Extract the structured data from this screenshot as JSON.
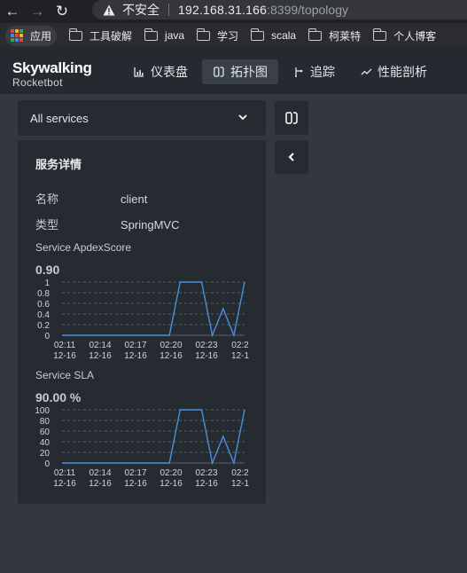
{
  "browser": {
    "insecure_label": "不安全",
    "url_host": "192.168.31.166",
    "url_rest": ":8399/topology",
    "bookmarks": [
      "应用",
      "工具破解",
      "java",
      "学习",
      "scala",
      "柯莱特",
      "个人博客"
    ]
  },
  "app": {
    "logo_main": "Skywalking",
    "logo_sub": "Rocketbot",
    "nav": [
      {
        "label": "仪表盘",
        "icon": "bar-chart-icon"
      },
      {
        "label": "拓扑图",
        "icon": "topology-icon"
      },
      {
        "label": "追踪",
        "icon": "trace-icon"
      },
      {
        "label": "性能剖析",
        "icon": "profile-line-icon"
      }
    ],
    "active_tab": "拓扑图"
  },
  "service_select": {
    "value": "All services"
  },
  "service_details": {
    "title": "服务详情",
    "fields": [
      {
        "key": "名称",
        "value": "client"
      },
      {
        "key": "类型",
        "value": "SpringMVC"
      }
    ]
  },
  "chart_data": [
    {
      "type": "line",
      "title": "Service ApdexScore",
      "current_value": "0.90",
      "x": [
        0,
        1,
        2,
        3,
        4,
        5,
        6,
        7,
        8,
        9,
        10,
        11,
        12,
        13,
        14,
        15,
        16
      ],
      "values": [
        0,
        0,
        0,
        0,
        0,
        0,
        0,
        0,
        0,
        0,
        0,
        1,
        1,
        1,
        0,
        0.5,
        0,
        1
      ],
      "x_tick_labels": [
        [
          "02:11",
          "12-16"
        ],
        [
          "02:14",
          "12-16"
        ],
        [
          "02:17",
          "12-16"
        ],
        [
          "02:20",
          "12-16"
        ],
        [
          "02:23",
          "12-16"
        ],
        [
          "02:2",
          "12-1"
        ]
      ],
      "y_ticks": [
        "1",
        "0.8",
        "0.6",
        "0.4",
        "0.2",
        "0"
      ],
      "ylim": [
        0,
        1
      ],
      "color": "#4a90d9"
    },
    {
      "type": "line",
      "title": "Service SLA",
      "current_value": "90.00 %",
      "values": [
        0,
        0,
        0,
        0,
        0,
        0,
        0,
        0,
        0,
        0,
        0,
        100,
        100,
        100,
        0,
        50,
        0,
        100
      ],
      "x_tick_labels": [
        [
          "02:11",
          "12-16"
        ],
        [
          "02:14",
          "12-16"
        ],
        [
          "02:17",
          "12-16"
        ],
        [
          "02:20",
          "12-16"
        ],
        [
          "02:23",
          "12-16"
        ],
        [
          "02:2",
          "12-1"
        ]
      ],
      "y_ticks": [
        "100",
        "80",
        "60",
        "40",
        "20",
        "0"
      ],
      "ylim": [
        0,
        100
      ],
      "color": "#4a90d9"
    }
  ]
}
